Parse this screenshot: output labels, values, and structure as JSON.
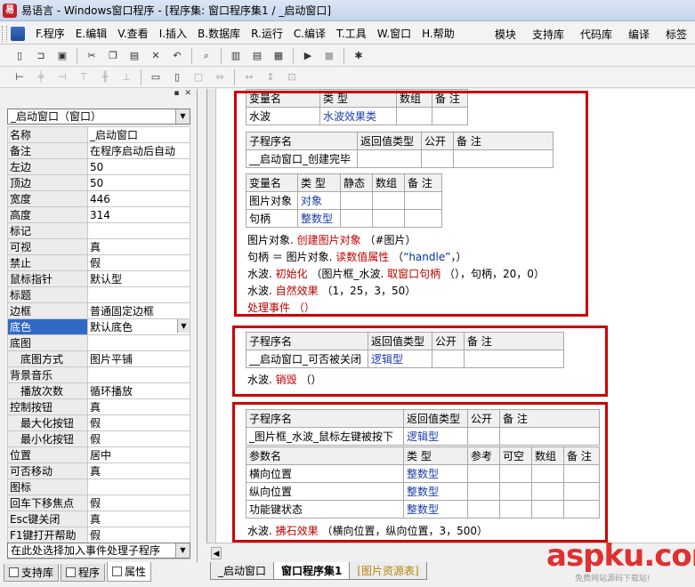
{
  "window": {
    "title": "易语言 - Windows窗口程序 - [程序集: 窗口程序集1 / _启动窗口]"
  },
  "menu": {
    "items": [
      "F.程序",
      "E.编辑",
      "V.查看",
      "I.插入",
      "B.数据库",
      "R.运行",
      "C.编译",
      "T.工具",
      "W.窗口",
      "H.帮助"
    ],
    "right": [
      "模块",
      "支持库",
      "代码库",
      "编译",
      "标签"
    ]
  },
  "toolbar1": {
    "icons": [
      "new-icon",
      "open-icon",
      "save-icon",
      "cut-icon",
      "copy-icon",
      "paste-icon",
      "delete-icon",
      "undo-icon",
      "redo-icon",
      "find-icon",
      "view-icon",
      "view2-icon",
      "view3-icon",
      "run-icon",
      "stop-icon",
      "debug-icon"
    ]
  },
  "properties": {
    "object": "_启动窗口（窗口）",
    "rows": [
      {
        "name": "名称",
        "value": "_启动窗口"
      },
      {
        "name": "备注",
        "value": "在程序启动后自动"
      },
      {
        "name": "左边",
        "value": "50"
      },
      {
        "name": "顶边",
        "value": "50"
      },
      {
        "name": "宽度",
        "value": "446"
      },
      {
        "name": "高度",
        "value": "314"
      },
      {
        "name": "标记",
        "value": ""
      },
      {
        "name": "可视",
        "value": "真"
      },
      {
        "name": "禁止",
        "value": "假"
      },
      {
        "name": "鼠标指针",
        "value": "默认型"
      },
      {
        "name": "标题",
        "value": ""
      },
      {
        "name": "边框",
        "value": "普通固定边框"
      },
      {
        "name": "底色",
        "value": "默认底色"
      },
      {
        "name": "底图",
        "value": ""
      },
      {
        "name": "底图方式",
        "value": "图片平铺"
      },
      {
        "name": "背景音乐",
        "value": ""
      },
      {
        "name": "播放次数",
        "value": "循环播放"
      },
      {
        "name": "控制按钮",
        "value": "真"
      },
      {
        "name": "最大化按钮",
        "value": "假"
      },
      {
        "name": "最小化按钮",
        "value": "假"
      },
      {
        "name": "位置",
        "value": "居中"
      },
      {
        "name": "可否移动",
        "value": "真"
      },
      {
        "name": "图标",
        "value": ""
      },
      {
        "name": "回车下移焦点",
        "value": "假"
      },
      {
        "name": "Esc键关闭",
        "value": "真"
      },
      {
        "name": "F1键打开帮助",
        "value": "假"
      },
      {
        "name": "帮助文件名",
        "value": ""
      }
    ],
    "hint": "在此处选择加入事件处理子程序"
  },
  "left_tabs": [
    "支持库",
    "程序",
    "属性"
  ],
  "code": {
    "b1_var_header": [
      "变量名",
      "类 型",
      "数组",
      "备 注"
    ],
    "b1_var_row": [
      "水波",
      "水波效果类",
      "",
      ""
    ],
    "b1_sub_header": [
      "子程序名",
      "返回值类型",
      "公开",
      "备 注"
    ],
    "b1_sub_row": [
      "__启动窗口_创建完毕",
      "",
      "",
      ""
    ],
    "b1_local_header": [
      "变量名",
      "类 型",
      "静态",
      "数组",
      "备 注"
    ],
    "b1_local_rows": [
      [
        "图片对象",
        "对象",
        "",
        "",
        ""
      ],
      [
        "句柄",
        "整数型",
        "",
        "",
        ""
      ]
    ],
    "b1_lines": [
      [
        "图片对象. ",
        "创建图片对象",
        " （#图片）",
        ""
      ],
      [
        "句柄 ＝ 图片对象. ",
        "读数值属性",
        " （",
        "“handle”",
        "，）"
      ],
      [
        "水波. ",
        "初始化",
        " （图片框_水波. ",
        "取窗口句柄",
        " （），句柄，20，0）"
      ],
      [
        "水波. ",
        "自然效果",
        " （1，25，3，50）"
      ],
      [
        "处理事件 （）"
      ]
    ],
    "b2_sub_header": [
      "子程序名",
      "返回值类型",
      "公开",
      "备 注"
    ],
    "b2_sub_row": [
      "__启动窗口_可否被关闭",
      "逻辑型",
      "",
      ""
    ],
    "b2_line": [
      "水波. ",
      "销毁",
      " （）"
    ],
    "b3_sub_header": [
      "子程序名",
      "返回值类型",
      "公开",
      "备 注"
    ],
    "b3_sub_row": [
      "_图片框_水波_鼠标左键被按下",
      "逻辑型",
      "",
      ""
    ],
    "b3_param_header": [
      "参数名",
      "类 型",
      "参考",
      "可空",
      "数组",
      "备 注"
    ],
    "b3_param_rows": [
      [
        "横向位置",
        "整数型",
        "",
        "",
        "",
        ""
      ],
      [
        "纵向位置",
        "整数型",
        "",
        "",
        "",
        ""
      ],
      [
        "功能键状态",
        "整数型",
        "",
        "",
        "",
        ""
      ]
    ],
    "b3_line": [
      "水波. ",
      "拂石效果",
      " （横向位置，纵向位置，3，500）"
    ]
  },
  "doc_tabs": [
    "_启动窗口",
    "窗口程序集1",
    "[图片资源表]"
  ],
  "watermark": {
    "main": "aspku.com",
    "sub": "免费网站源码下载站!"
  },
  "colors": {
    "highlight": "#316ac5",
    "red_box": "#cc0000",
    "keyword": "#1a3da8",
    "function": "#c00000"
  }
}
